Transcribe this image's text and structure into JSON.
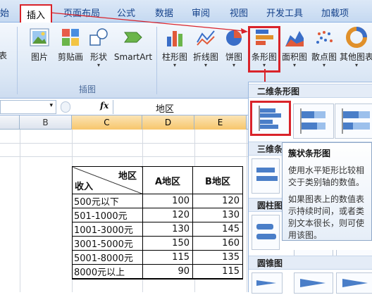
{
  "tabs": [
    "始",
    "插入",
    "页面布局",
    "公式",
    "数据",
    "审阅",
    "视图",
    "开发工具",
    "加载项"
  ],
  "ribbon": {
    "left_partial": "表",
    "buttons": [
      {
        "label": "图片",
        "icon": "picture-icon"
      },
      {
        "label": "剪贴画",
        "icon": "clipart-icon"
      },
      {
        "label": "形状",
        "icon": "shapes-icon",
        "dropdown": "▾"
      },
      {
        "label": "SmartArt",
        "icon": "smartart-icon"
      },
      {
        "label": "柱形图",
        "icon": "column-chart-icon",
        "dropdown": "▾"
      },
      {
        "label": "折线图",
        "icon": "line-chart-icon",
        "dropdown": "▾"
      },
      {
        "label": "饼图",
        "icon": "pie-chart-icon",
        "dropdown": "▾"
      },
      {
        "label": "条形图",
        "icon": "bar-chart-icon",
        "dropdown": "▾"
      },
      {
        "label": "面积图",
        "icon": "area-chart-icon",
        "dropdown": "▾"
      },
      {
        "label": "散点图",
        "icon": "scatter-chart-icon",
        "dropdown": "▾"
      },
      {
        "label": "其他图表",
        "icon": "other-charts-icon",
        "dropdown": "▾"
      }
    ],
    "group_illustrations": "插图"
  },
  "formula_bar": {
    "name_dropdown": "▾",
    "fx": "fx",
    "value": "地区"
  },
  "columns": [
    "B",
    "C",
    "D",
    "E"
  ],
  "table": {
    "header_top": "地区",
    "header_bottom": "收入",
    "col_a": "A地区",
    "col_b": "B地区",
    "rows": [
      {
        "label": "500元以下",
        "a": "100",
        "b": "120"
      },
      {
        "label": "501-1000元",
        "a": "120",
        "b": "130"
      },
      {
        "label": "1001-3000元",
        "a": "130",
        "b": "145"
      },
      {
        "label": "3001-5000元",
        "a": "150",
        "b": "160"
      },
      {
        "label": "5001-8000元",
        "a": "115",
        "b": "135"
      },
      {
        "label": "8000元以上",
        "a": "90",
        "b": "115"
      }
    ]
  },
  "dropdown_panel": {
    "section_2d": "二维条形图",
    "section_3d": "三维条",
    "section_cyl": "圆柱图",
    "section_cone": "圆锥图"
  },
  "tooltip": {
    "title": "簇状条形图",
    "line1": "使用水平矩形比较相交于类别轴的数值。",
    "line2": "如果图表上的数值表示持续时间，或者类别文本很长，则可使用该图。"
  },
  "colors": {
    "accent_red": "#d9232a",
    "ribbon_blue": "#c5d9f1",
    "header_highlight": "#f7c66b"
  }
}
